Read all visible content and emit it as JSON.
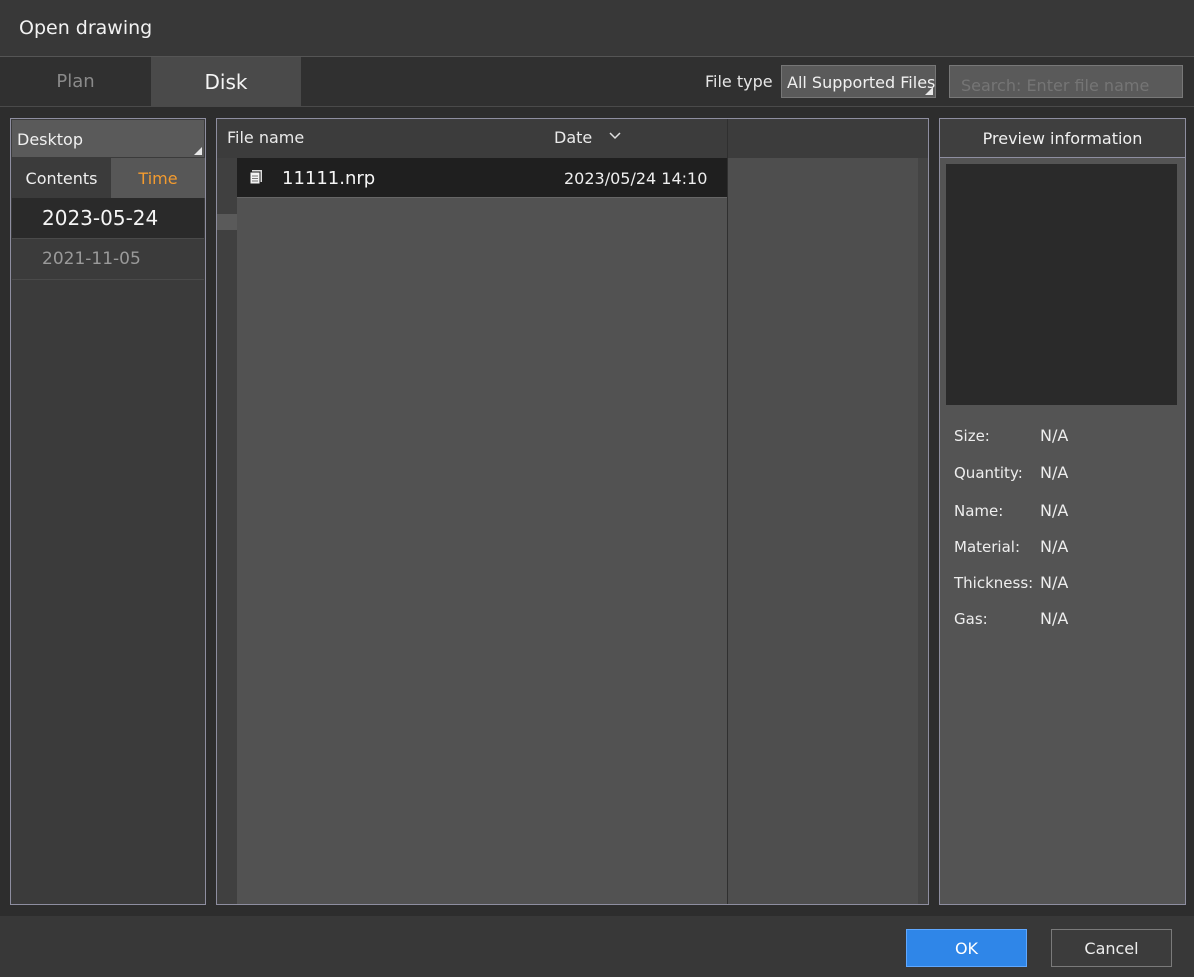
{
  "window": {
    "title": "Open drawing"
  },
  "tabs": [
    {
      "label": "Plan",
      "active": false
    },
    {
      "label": "Disk",
      "active": true
    }
  ],
  "filter": {
    "file_type_label": "File type",
    "file_type_value": "All Supported Files",
    "search_placeholder": "Search: Enter file name"
  },
  "sidebar": {
    "location": "Desktop",
    "subtabs": [
      {
        "label": "Contents",
        "active": false
      },
      {
        "label": "Time",
        "active": true
      }
    ],
    "dates": [
      {
        "label": "2023-05-24",
        "selected": true
      },
      {
        "label": "2021-11-05",
        "selected": false
      }
    ]
  },
  "file_list": {
    "columns": {
      "name": "File name",
      "date": "Date"
    },
    "rows": [
      {
        "name": "11111.nrp",
        "date": "2023/05/24 14:10",
        "icon": "file-icon"
      }
    ]
  },
  "preview": {
    "title": "Preview information",
    "fields": [
      {
        "label": "Size:",
        "value": "N/A"
      },
      {
        "label": "Quantity:",
        "value": "N/A"
      },
      {
        "label": "Name:",
        "value": "N/A"
      },
      {
        "label": "Material:",
        "value": "N/A"
      },
      {
        "label": "Thickness:",
        "value": "N/A"
      },
      {
        "label": "Gas:",
        "value": "N/A"
      }
    ]
  },
  "buttons": {
    "ok": "OK",
    "cancel": "Cancel"
  },
  "colors": {
    "accent": "#2f86e8",
    "active_subtab_text": "#f39b2f"
  }
}
